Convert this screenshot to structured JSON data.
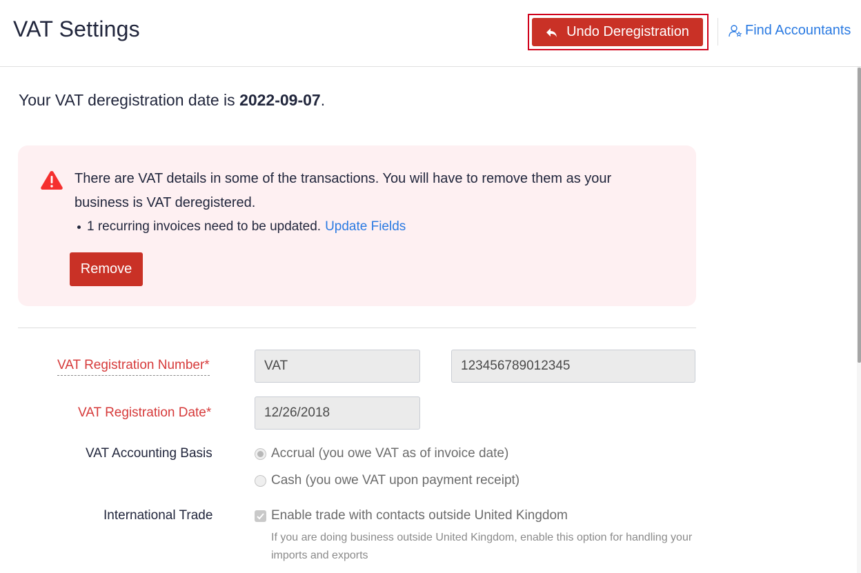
{
  "header": {
    "title": "VAT Settings",
    "undo_button_label": "Undo Deregistration",
    "undo_icon": "reply-arrow-icon",
    "find_accountants_label": "Find Accountants",
    "find_accountants_icon": "user-star-icon"
  },
  "deregistration": {
    "prefix": "Your VAT deregistration date is ",
    "date": "2022-09-07",
    "suffix": "."
  },
  "alert": {
    "icon": "warning-triangle-icon",
    "message": "There are VAT details in some of the transactions. You will have to remove them as your business is VAT deregistered.",
    "bullet_text": "1 recurring invoices need to be updated.",
    "bullet_link": "Update Fields",
    "remove_button_label": "Remove"
  },
  "form": {
    "vat_number": {
      "label": "VAT Registration Number*",
      "prefix_value": "VAT",
      "number_value": "123456789012345"
    },
    "vat_date": {
      "label": "VAT Registration Date*",
      "value": "12/26/2018"
    },
    "accounting_basis": {
      "label": "VAT Accounting Basis",
      "options": [
        {
          "label": "Accrual (you owe VAT as of invoice date)",
          "selected": true
        },
        {
          "label": "Cash (you owe VAT upon payment receipt)",
          "selected": false
        }
      ]
    },
    "international_trade": {
      "label": "International Trade",
      "checkbox_label": "Enable trade with contacts outside United Kingdom",
      "checked": true,
      "help_text": "If you are doing business outside United Kingdom, enable this option for handling your imports and exports"
    }
  },
  "colors": {
    "primary_red": "#c93126",
    "link_blue": "#2a7ae2",
    "required_red": "#d63a3a",
    "alert_bg": "#fef0f2",
    "highlight_border": "#d0021b"
  }
}
